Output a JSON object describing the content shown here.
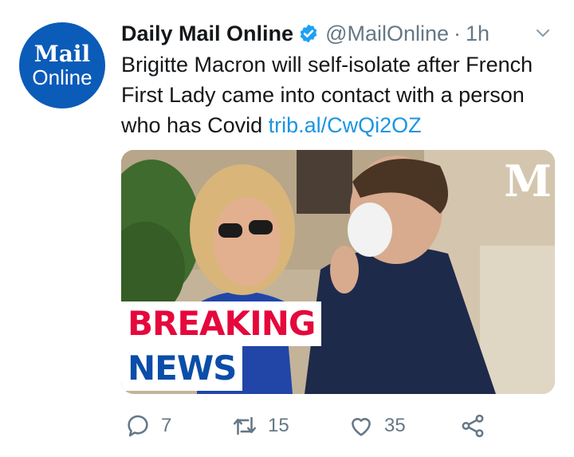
{
  "avatar": {
    "line1": "Mail",
    "line2": "Online",
    "color": "#0b5bb8"
  },
  "tweet": {
    "display_name": "Daily Mail Online",
    "handle": "@MailOnline",
    "separator": "·",
    "time": "1h",
    "text": "Brigitte Macron will self-isolate after French First Lady came into contact with a person who has Covid ",
    "link": "trib.al/CwQi2OZ"
  },
  "media": {
    "watermark": "M",
    "overlay_line1": "BREAKING",
    "overlay_line2": "NEWS",
    "overlay_color1": "#e5083c",
    "overlay_color2": "#0b4da8"
  },
  "actions": {
    "reply_count": "7",
    "retweet_count": "15",
    "like_count": "35"
  },
  "colors": {
    "link": "#1b95e0",
    "muted": "#657786",
    "verified": "#1da1f2"
  }
}
